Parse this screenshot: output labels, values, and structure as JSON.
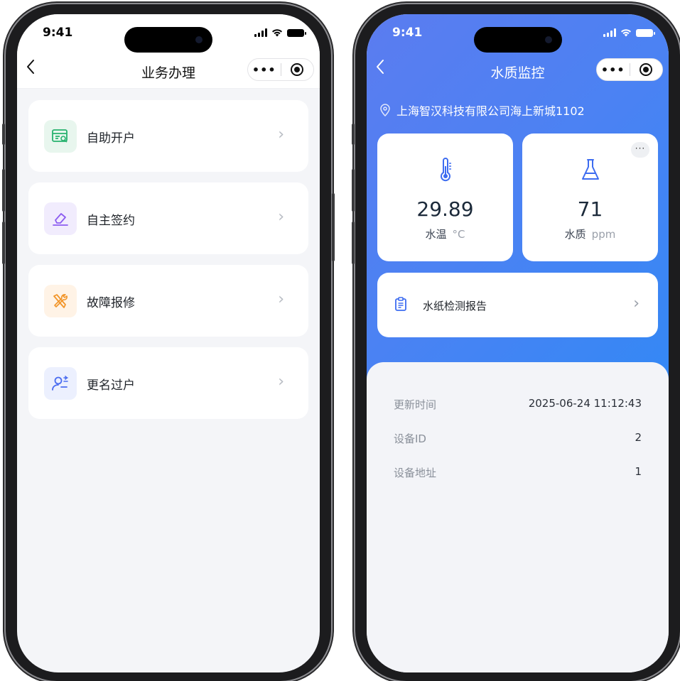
{
  "status_bar": {
    "time": "9:41"
  },
  "left_screen": {
    "title": "业务办理",
    "back_icon": "chevron-left-icon",
    "menu_items": [
      {
        "label": "自助开户",
        "icon": "id-card-icon",
        "icon_color": "#27b26f",
        "icon_bg": "#e8f6ee"
      },
      {
        "label": "自主签约",
        "icon": "sign-eraser-icon",
        "icon_color": "#8c5cf0",
        "icon_bg": "#f1ecfd"
      },
      {
        "label": "故障报修",
        "icon": "wrench-icon",
        "icon_color": "#f2962b",
        "icon_bg": "#fff3e6"
      },
      {
        "label": "更名过户",
        "icon": "user-transfer-icon",
        "icon_color": "#4a6cf0",
        "icon_bg": "#ecf0fe"
      }
    ]
  },
  "right_screen": {
    "title": "水质监控",
    "location": "上海智汉科技有限公司海上新城1102",
    "metrics": [
      {
        "value": "29.89",
        "label": "水温",
        "unit": "°C",
        "icon": "thermometer-icon"
      },
      {
        "value": "71",
        "label": "水质",
        "unit": "ppm",
        "icon": "flask-icon"
      }
    ],
    "more_label": "···",
    "report_label": "水纸检测报告",
    "info": [
      {
        "key": "更新时间",
        "value": "2025-06-24 11:12:43"
      },
      {
        "key": "设备ID",
        "value": "2"
      },
      {
        "key": "设备地址",
        "value": "1"
      }
    ]
  },
  "capsule": {
    "more": "•••"
  },
  "colors": {
    "accent_blue": "#4b82f3",
    "background": "#f4f5f8"
  }
}
